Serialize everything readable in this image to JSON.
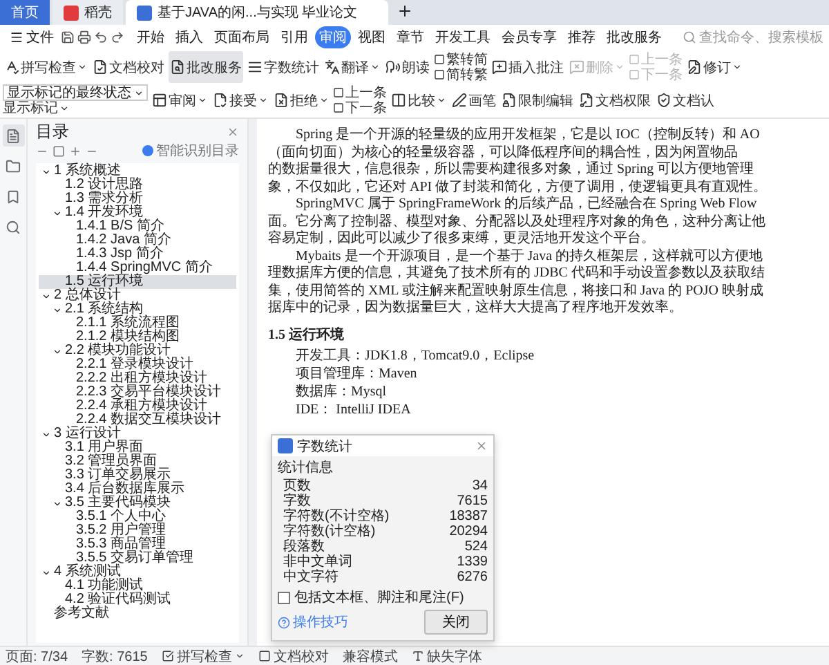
{
  "tabs": [
    {
      "kind": "home",
      "label": "首页",
      "selected": false
    },
    {
      "kind": "app",
      "label": "稻壳",
      "selected": false
    },
    {
      "kind": "doc",
      "label": "基于JAVA的闲...与实现 毕业论文",
      "selected": true
    }
  ],
  "menu": {
    "file": "文件",
    "items": [
      {
        "label": "开始",
        "selected": false
      },
      {
        "label": "插入",
        "selected": false
      },
      {
        "label": "页面布局",
        "selected": false
      },
      {
        "label": "引用",
        "selected": false
      },
      {
        "label": "审阅",
        "selected": true
      },
      {
        "label": "视图",
        "selected": false
      },
      {
        "label": "章节",
        "selected": false
      },
      {
        "label": "开发工具",
        "selected": false
      },
      {
        "label": "会员专享",
        "selected": false
      },
      {
        "label": "推荐",
        "selected": false
      },
      {
        "label": "批改服务",
        "selected": false
      }
    ],
    "search": {
      "placeholder": "查找命令、搜索模板"
    }
  },
  "ribbon": [
    {
      "kind": "button",
      "label": "拼写检查",
      "dropdown": true,
      "disabled": false,
      "active": false
    },
    {
      "kind": "button",
      "label": "文档校对",
      "dropdown": false,
      "disabled": false,
      "active": false
    },
    {
      "kind": "button",
      "label": "批改服务",
      "dropdown": false,
      "disabled": false,
      "active": true
    },
    {
      "kind": "button",
      "label": "字数统计",
      "dropdown": false,
      "disabled": false,
      "active": false
    },
    {
      "kind": "button",
      "label": "翻译",
      "dropdown": true,
      "disabled": false,
      "active": false
    },
    {
      "kind": "button",
      "label": "朗读",
      "dropdown": false,
      "disabled": false,
      "active": false
    },
    {
      "kind": "stack",
      "labels": [
        "繁转简",
        "简转繁"
      ],
      "disabled": false
    },
    {
      "kind": "button",
      "label": "插入批注",
      "dropdown": false,
      "disabled": false,
      "active": false
    },
    {
      "kind": "button",
      "label": "删除",
      "dropdown": true,
      "disabled": true,
      "active": false
    },
    {
      "kind": "stack",
      "labels": [
        "上一条",
        "下一条"
      ],
      "disabled": true
    },
    {
      "kind": "button",
      "label": "修订",
      "dropdown": true,
      "disabled": false,
      "active": false
    },
    {
      "kind": "select",
      "value": "显示标记的最终状态",
      "label": "显示标记"
    },
    {
      "kind": "button",
      "label": "审阅",
      "dropdown": true,
      "disabled": false,
      "active": false
    },
    {
      "kind": "button",
      "label": "接受",
      "dropdown": true,
      "disabled": false,
      "active": false
    },
    {
      "kind": "button",
      "label": "拒绝",
      "dropdown": true,
      "disabled": false,
      "active": false
    },
    {
      "kind": "stack",
      "labels": [
        "上一条",
        "下一条"
      ],
      "disabled": false
    },
    {
      "kind": "button",
      "label": "比较",
      "dropdown": true,
      "disabled": false,
      "active": false
    },
    {
      "kind": "button",
      "label": "画笔",
      "dropdown": false,
      "disabled": false,
      "active": false
    },
    {
      "kind": "button",
      "label": "限制编辑",
      "dropdown": false,
      "disabled": false,
      "active": false
    },
    {
      "kind": "button",
      "label": "文档权限",
      "dropdown": false,
      "disabled": false,
      "active": false
    },
    {
      "kind": "button",
      "label": "文档认",
      "dropdown": false,
      "disabled": false,
      "active": false
    }
  ],
  "rail": [
    {
      "selected": true
    },
    {
      "selected": false
    },
    {
      "selected": false
    },
    {
      "selected": false
    }
  ],
  "toc": {
    "title": "目录",
    "smart": "智能识别目录",
    "items": [
      {
        "label": "1 系统概述",
        "expanded": true,
        "selected": false,
        "children": [
          {
            "label": "1.2 设计思路",
            "selected": false
          },
          {
            "label": "1.3 需求分析",
            "selected": false
          },
          {
            "label": "1.4 开发环境",
            "expanded": true,
            "selected": false,
            "children": [
              {
                "label": "1.4.1 B/S 简介",
                "selected": false
              },
              {
                "label": "1.4.2 Java 简介",
                "selected": false
              },
              {
                "label": "1.4.3 Jsp 简介",
                "selected": false
              },
              {
                "label": "1.4.4 SpringMVC 简介",
                "selected": false
              }
            ]
          },
          {
            "label": "1.5 运行环境",
            "selected": true
          }
        ]
      },
      {
        "label": "2 总体设计",
        "expanded": true,
        "selected": false,
        "children": [
          {
            "label": "2.1 系统结构",
            "expanded": true,
            "selected": false,
            "children": [
              {
                "label": "2.1.1 系统流程图",
                "selected": false
              },
              {
                "label": "2.1.2 模块结构图",
                "selected": false
              }
            ]
          },
          {
            "label": "2.2 模块功能设计",
            "expanded": true,
            "selected": false,
            "children": [
              {
                "label": "2.2.1 登录模块设计",
                "selected": false
              },
              {
                "label": "2.2.2 出租方模块设计",
                "selected": false
              },
              {
                "label": "2.2.3 交易平台模块设计",
                "selected": false
              },
              {
                "label": "2.2.4 承租方模块设计",
                "selected": false
              },
              {
                "label": "2.2.4 数据交互模块设计",
                "selected": false
              }
            ]
          }
        ]
      },
      {
        "label": "3 运行设计",
        "expanded": true,
        "selected": false,
        "children": [
          {
            "label": "3.1 用户界面",
            "selected": false
          },
          {
            "label": "3.2 管理员界面",
            "selected": false
          },
          {
            "label": "3.3 订单交易展示",
            "selected": false
          },
          {
            "label": "3.4 后台数据库展示",
            "selected": false
          },
          {
            "label": "3.5 主要代码模块",
            "expanded": true,
            "selected": false,
            "children": [
              {
                "label": "3.5.1 个人中心",
                "selected": false
              },
              {
                "label": "3.5.2 用户管理",
                "selected": false
              },
              {
                "label": "3.5.3 商品管理",
                "selected": false
              },
              {
                "label": "3.5.5 交易订单管理",
                "selected": false
              }
            ]
          }
        ]
      },
      {
        "label": "4 系统测试",
        "expanded": true,
        "selected": false,
        "children": [
          {
            "label": "4.1 功能测试",
            "selected": false
          },
          {
            "label": "4.2 验证代码测试",
            "selected": false
          }
        ]
      },
      {
        "label": "参考文献",
        "selected": false
      }
    ]
  },
  "document": {
    "paragraphs": [
      [
        "Spring 是一个开源的轻量级的应用开发框架，它是以 IOC（控制反转）和 AO",
        "（面向切面）为核心的轻量级容器，可以降低程序间的耦合性，因为闲置物品",
        "的数据量很大，信息很杂，所以需要构建很多对象，通过 Spring 可以方便地管理",
        "象，不仅如此，它还对 API 做了封装和简化，方便了调用，使逻辑更具有直观性。"
      ],
      [
        "SpringMVC 属于 SpringFrameWork 的后续产品，已经融合在 Spring Web Flow",
        "面。它分离了控制器、模型对象、分配器以及处理程序对象的角色，这种分离让他",
        "容易定制，因此可以减少了很多束缚，更灵活地开发这个平台。"
      ],
      [
        "Mybaits 是一个开源项目，是一个基于 Java 的持久框架层，这样就可以方便地",
        "理数据库方便的信息，其避免了技术所有的 JDBC 代码和手动设置参数以及获取结",
        "集，使用简答的 XML 或注解来配置映射原生信息，将接口和 Java 的 POJO 映射成",
        "据库中的记录，因为数据量巨大，这样大大提高了程序地开发效率。"
      ]
    ],
    "heading": "1.5 运行环境",
    "lines": [
      "开发工具：JDK1.8，Tomcat9.0，Eclipse",
      "项目管理库：Maven",
      "数据库：Mysql",
      "IDE：  IntelliJ IDEA"
    ]
  },
  "dialog": {
    "title": "字数统计",
    "section": "统计信息",
    "rows": [
      {
        "label": "页数",
        "value": "34"
      },
      {
        "label": "字数",
        "value": "7615"
      },
      {
        "label": "字符数(不计空格)",
        "value": "18387"
      },
      {
        "label": "字符数(计空格)",
        "value": "20294"
      },
      {
        "label": "段落数",
        "value": "524"
      },
      {
        "label": "非中文单词",
        "value": "1339"
      },
      {
        "label": "中文字符",
        "value": "6276"
      }
    ],
    "checkbox": {
      "label": "包括文本框、脚注和尾注(F)",
      "checked": false
    },
    "tips": "操作技巧",
    "close": "关闭"
  },
  "status": {
    "page": "页面: 7/34",
    "words": "字数: 7615",
    "spell": "拼写检查",
    "proof": "文档校对",
    "compat": "兼容模式",
    "fonts": "缺失字体"
  }
}
